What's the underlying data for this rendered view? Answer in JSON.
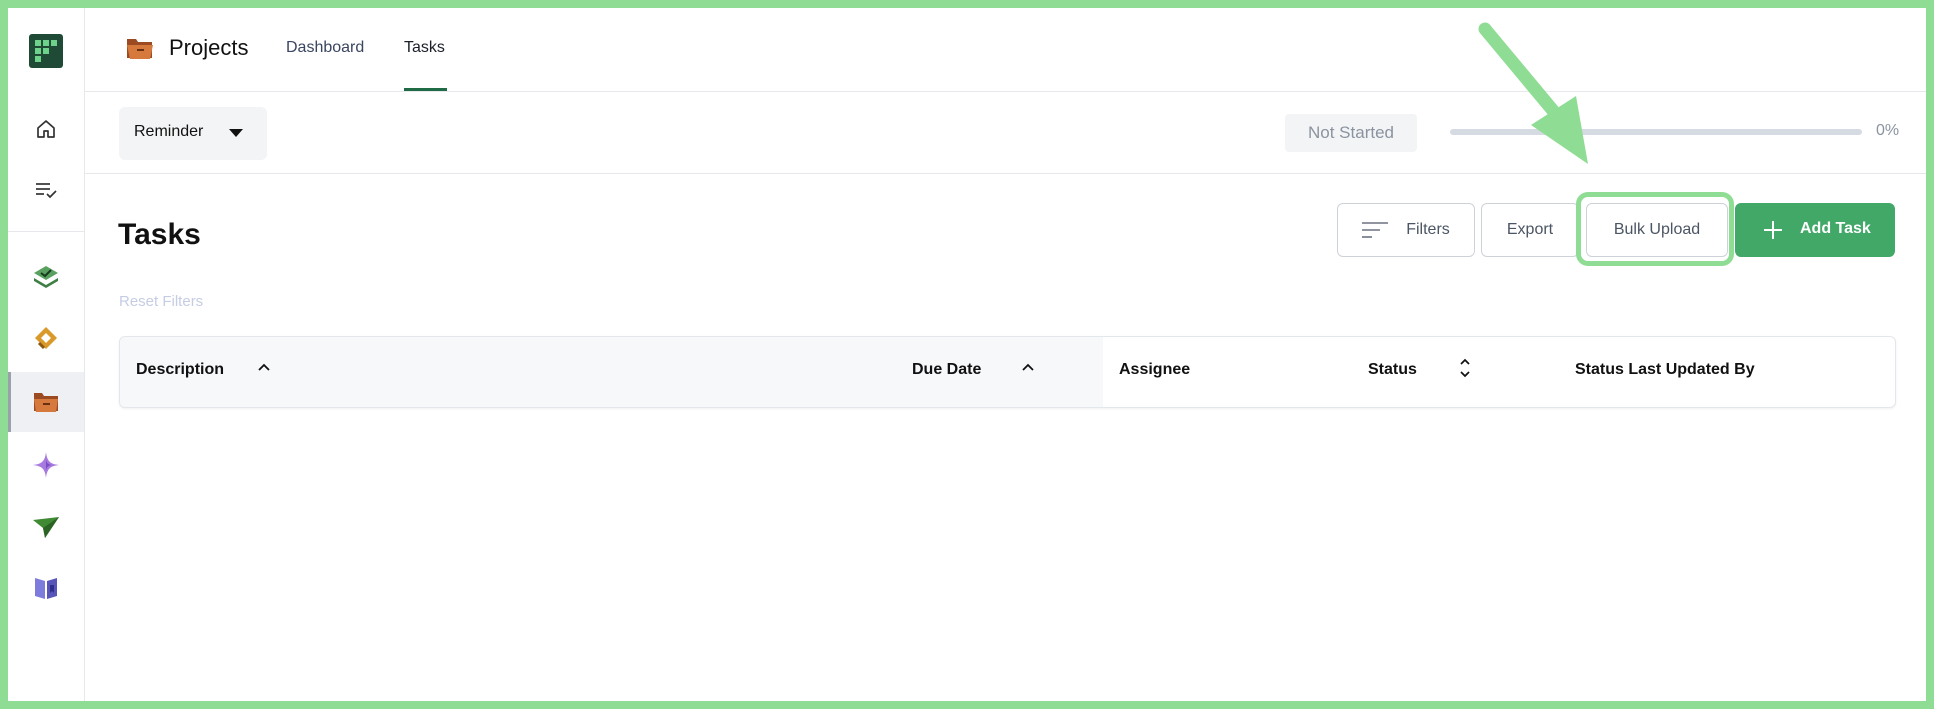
{
  "app": {
    "title": "Projects",
    "title_icon": "folder-icon"
  },
  "sidebar": {
    "items": [
      {
        "name": "home",
        "icon": "home-icon"
      },
      {
        "name": "checklist",
        "icon": "list-check-icon"
      },
      {
        "name": "approvals",
        "icon": "layers-check-icon"
      },
      {
        "name": "integrations",
        "icon": "link-icon"
      },
      {
        "name": "projects",
        "icon": "folder-icon",
        "active": true
      },
      {
        "name": "ai",
        "icon": "sparkle-icon"
      },
      {
        "name": "send",
        "icon": "paper-plane-icon"
      },
      {
        "name": "docs",
        "icon": "book-icon"
      }
    ]
  },
  "tabs": [
    {
      "label": "Dashboard",
      "active": false
    },
    {
      "label": "Tasks",
      "active": true
    }
  ],
  "reminder": {
    "label": "Reminder"
  },
  "status": {
    "label": "Not Started",
    "progress_percent": 0,
    "progress_label": "0%"
  },
  "main": {
    "title": "Tasks",
    "reset_filters_label": "Reset Filters",
    "buttons": {
      "filters": "Filters",
      "export": "Export",
      "bulk_upload": "Bulk Upload",
      "add_task": "Add Task"
    }
  },
  "table": {
    "columns": [
      {
        "label": "Description",
        "sort": "asc"
      },
      {
        "label": "Due Date",
        "sort": "asc"
      },
      {
        "label": "Assignee",
        "sort": null
      },
      {
        "label": "Status",
        "sort": "both"
      },
      {
        "label": "Status Last Updated By",
        "sort": null
      }
    ],
    "rows": []
  },
  "colors": {
    "accent_green": "#41a868",
    "tab_underline": "#1e6b45",
    "annotation_green": "#8fdd94"
  }
}
